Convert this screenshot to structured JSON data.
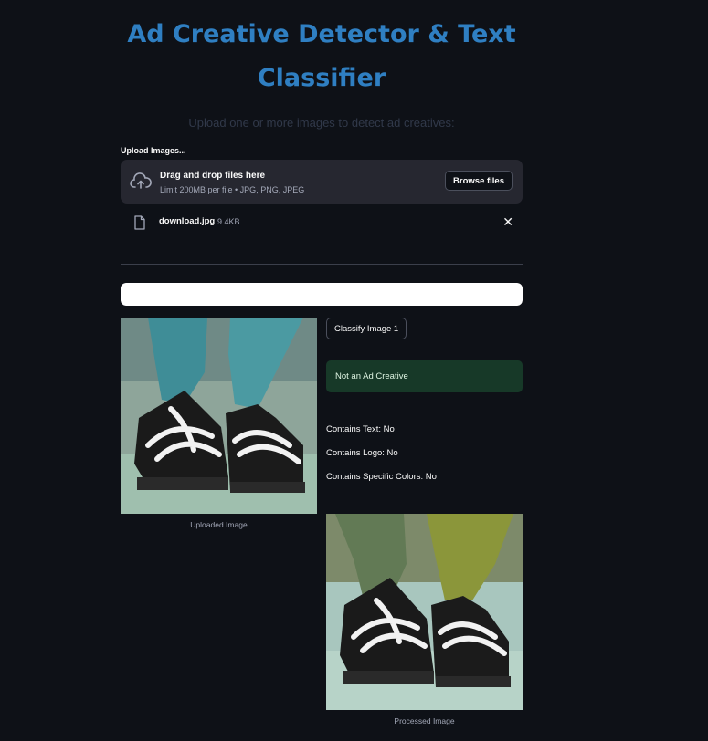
{
  "header": {
    "title_line1": "Ad Creative Detector & Text",
    "title_line2": "Classifier",
    "subtitle": "Upload one or more images to detect ad creatives:"
  },
  "uploader": {
    "label": "Upload Images...",
    "drag_text": "Drag and drop files here",
    "limit_text": "Limit 200MB per file • JPG, PNG, JPEG",
    "browse_label": "Browse files",
    "files": [
      {
        "name": "download.jpg",
        "size": "9.4KB"
      }
    ]
  },
  "progress": {
    "value": 1.0
  },
  "result": {
    "uploaded_caption": "Uploaded Image",
    "processed_caption": "Processed Image",
    "classify_label": "Classify Image 1",
    "status": "Not an Ad Creative",
    "contains_text": "Contains Text: No",
    "contains_logo": "Contains Logo: No",
    "contains_colors": "Contains Specific Colors: No"
  },
  "icons": {
    "upload": "cloud-upload-icon",
    "file": "file-icon",
    "close": "close-icon"
  },
  "colors": {
    "background": "#0e1117",
    "title": "#2f7fc2",
    "success_bg": "#173928",
    "surface": "#262730"
  }
}
